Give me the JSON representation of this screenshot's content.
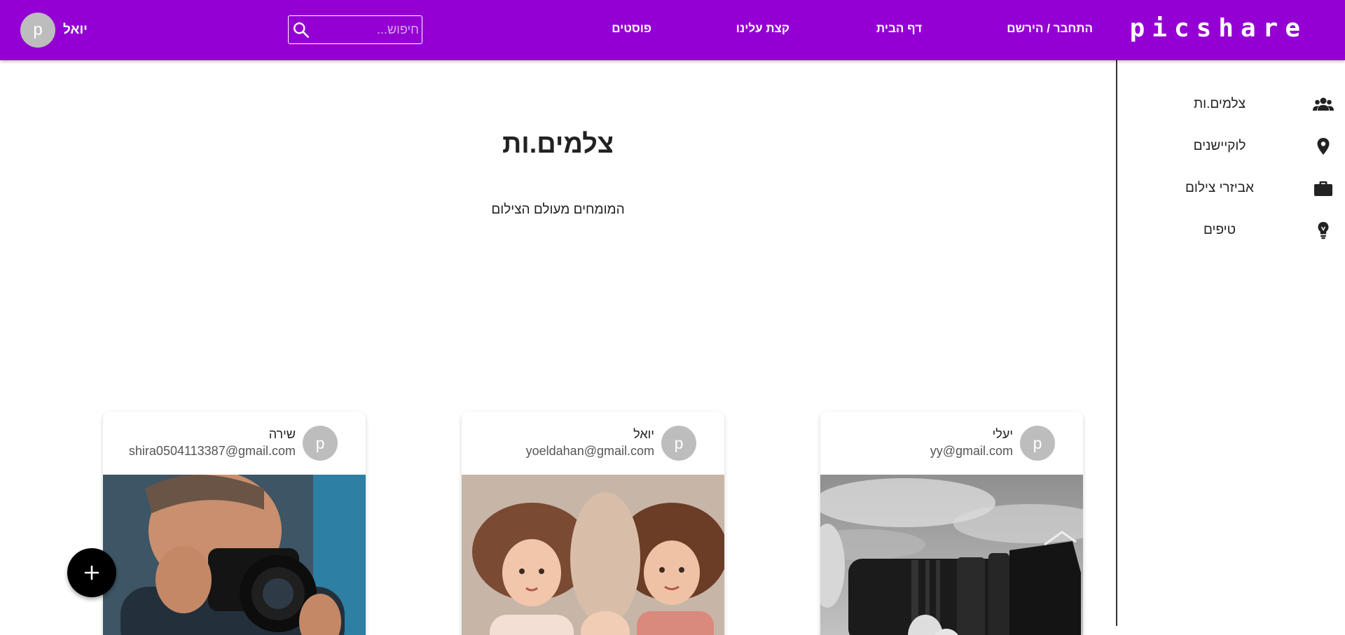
{
  "header": {
    "brand": "picshare",
    "nav": {
      "login": "התחבר / הירשם",
      "home": "דף הבית",
      "about": "קצת עלינו",
      "posts": "פוסטים"
    },
    "search": {
      "placeholder": "חיפוש..."
    },
    "user": {
      "avatar_letter": "p",
      "name": "יואל"
    }
  },
  "sidebar": {
    "items": [
      {
        "label": "צלמים.ות",
        "icon": "people-icon"
      },
      {
        "label": "לוקיישנים",
        "icon": "location-pin-icon"
      },
      {
        "label": "אביזרי צילום",
        "icon": "briefcase-icon"
      },
      {
        "label": "טיפים",
        "icon": "lightbulb-icon"
      }
    ]
  },
  "main": {
    "title": "צלמים.ות",
    "subtitle": "המומחים מעולם הצילום"
  },
  "cards": [
    {
      "avatar_letter": "p",
      "name": "יעלי",
      "email": "yy@gmail.com",
      "image": "camera-lens-photo"
    },
    {
      "avatar_letter": "p",
      "name": "יואל",
      "email": "yoeldahan@gmail.com",
      "image": "children-photo"
    },
    {
      "avatar_letter": "p",
      "name": "שירה",
      "email": "shira0504113387@gmail.com",
      "image": "photographer-photo"
    }
  ],
  "colors": {
    "primary": "#9400d3",
    "fab": "#000000",
    "avatar": "#bdbdbd"
  },
  "fab": {
    "icon": "plus-icon"
  }
}
